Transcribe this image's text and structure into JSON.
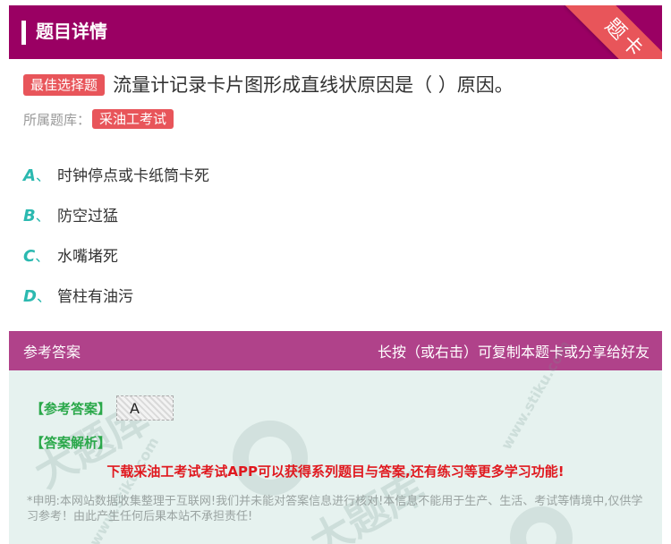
{
  "header": {
    "title": "题目详情",
    "corner_label": "题卡"
  },
  "question": {
    "type_badge": "最佳选择题",
    "text": "流量计记录卡片图形成直线状原因是（ ）原因。"
  },
  "bank": {
    "label": "所属题库：",
    "tag": "采油工考试"
  },
  "options": [
    {
      "letter": "A",
      "sep": "、",
      "text": "时钟停点或卡纸筒卡死"
    },
    {
      "letter": "B",
      "sep": "、",
      "text": "防空过猛"
    },
    {
      "letter": "C",
      "sep": "、",
      "text": "水嘴堵死"
    },
    {
      "letter": "D",
      "sep": "、",
      "text": "管柱有油污"
    }
  ],
  "answer_panel": {
    "title": "参考答案",
    "hint": "长按（或右击）可复制本题卡或分享给好友",
    "answer_label": "【参考答案】",
    "answer_value": "A",
    "analysis_label": "【答案解析】",
    "promo": "下载采油工考试考试APP可以获得系列题目与答案,还有练习等更多学习功能!",
    "disclaimer": "*申明:本网站数据收集整理于互联网!我们并未能对答案信息进行核对!本信息不能用于生产、生活、考试等情境中,仅供学习参考！由此产生任何后果本站不承担责任!"
  },
  "colors": {
    "header_bg": "#9a0063",
    "accent_red": "#e8555a",
    "option_letter": "#2bb9b0",
    "panel_head": "#b0428a",
    "panel_bg": "#e6f2ef",
    "answer_green": "#2aa84a",
    "promo_red": "#e0191f"
  },
  "watermark": {
    "brand": "大题库",
    "site": "www.stiku.com"
  }
}
